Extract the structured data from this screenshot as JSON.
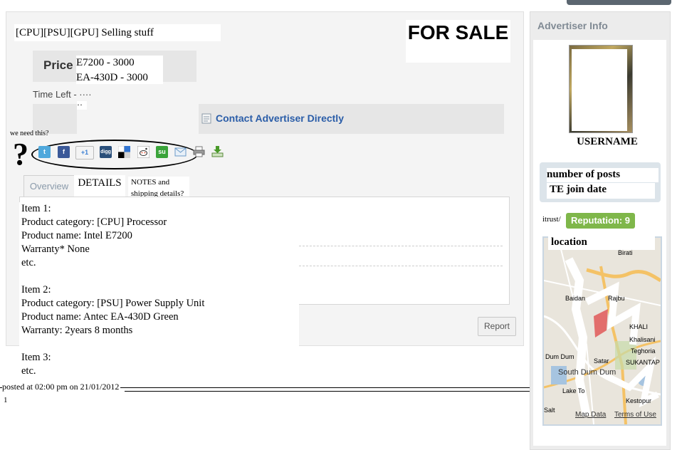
{
  "post": {
    "title": "[CPU][PSU][GPU] Selling stuff",
    "sale_banner": "FOR SALE",
    "price_label": "Price",
    "price_lines": [
      "E7200 - 3000",
      "EA-430D - 3000"
    ],
    "time_left_label": "Time Left - ····",
    "time_left_dots": "··",
    "contact_label": "Contact Advertiser Directly",
    "annotation_share": "we need this?",
    "annotation_question": "?",
    "share_icons": [
      "twitter-icon",
      "facebook-icon",
      "google-plus-icon",
      "digg-icon",
      "delicious-icon",
      "reddit-icon",
      "stumbleupon-icon",
      "email-icon",
      "print-icon",
      "download-icon"
    ],
    "share_glyphs": {
      "twitter": "t",
      "facebook": "f",
      "google_plus": "+1",
      "digg": "digg",
      "stumbleupon": "su"
    },
    "tabs": {
      "overview": "Overview",
      "details": "DETAILS",
      "notes": "NOTES and shipping details?"
    },
    "description_lines": [
      "Item 1:",
      "Product category: [CPU] Processor",
      "Product name: Intel E7200",
      "Warranty* None",
      "etc.",
      "",
      "Item 2:",
      "Product category: [PSU] Power Supply Unit",
      "Product name: Antec EA-430D Green",
      "Warranty: 2years 8 months",
      "",
      "Item 3:",
      "etc."
    ],
    "report_button": "Report",
    "posted": "posted at 02:00 pm on 21/01/2012",
    "posted_marker": "1"
  },
  "sidebar": {
    "heading": "Advertiser Info",
    "username": "USERNAME",
    "posts_label": "number of posts",
    "join_label": "TE join date",
    "trust_label": "itrust/",
    "reputation": "Reputation: 9",
    "location_label": "location",
    "map": {
      "labels": [
        "Birati",
        "Dum Dum",
        "South Dum Dum",
        "Lake To",
        "Baidan",
        "Rajbu",
        "KHALI",
        "Khalisani",
        "Teghoria",
        "SUKANTAP",
        "Satar",
        "Kestopur",
        "Salt"
      ],
      "map_data_link": "Map Data",
      "terms_link": "Terms of Use",
      "colors": {
        "water": "#a6c4e0",
        "road": "#f4c266",
        "land": "#e9e5dc",
        "park": "#c6dba9"
      }
    }
  },
  "colors": {
    "link_blue": "#2a5da8",
    "reputation_green": "#7fb74a",
    "tab_grey": "#8a9aaa"
  }
}
